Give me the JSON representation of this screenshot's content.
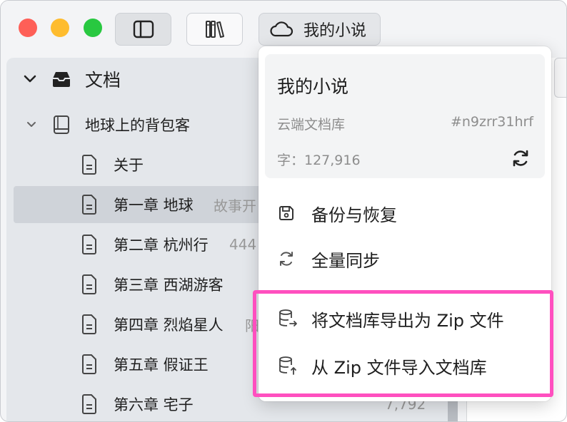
{
  "toolbar": {
    "sidebar_toggle_icon": "sidebar-icon",
    "library_icon": "books-icon",
    "cloud_icon": "cloud-icon",
    "cloud_label": "我的小说"
  },
  "sidebar": {
    "root": {
      "label": "文档",
      "icon": "tray-icon"
    },
    "book": {
      "label": "地球上的背包客",
      "icon": "book-icon"
    },
    "items": [
      {
        "label": "关于",
        "meta": "",
        "count": ""
      },
      {
        "label": "第一章 地球",
        "meta": "故事开",
        "count": ""
      },
      {
        "label": "第二章 杭州行",
        "meta": "444",
        "count": ""
      },
      {
        "label": "第三章 西湖游客",
        "meta": "",
        "count": ""
      },
      {
        "label": "第四章 烈焰星人",
        "meta": "阳",
        "count": ""
      },
      {
        "label": "第五章 假证王",
        "meta": "",
        "count": ""
      },
      {
        "label": "第六章 宅子",
        "meta": "",
        "count": "7,792"
      }
    ]
  },
  "menu": {
    "info": {
      "title": "我的小说",
      "type": "云端文档库",
      "id": "#n9zrr31hrf",
      "words": "字：127,916"
    },
    "items": [
      {
        "label": "备份与恢复",
        "icon": "backup-icon"
      },
      {
        "label": "全量同步",
        "icon": "sync-icon"
      },
      {
        "label": "将文档库导出为 Zip 文件",
        "icon": "database-export-icon"
      },
      {
        "label": "从 Zip 文件导入文档库",
        "icon": "database-import-icon"
      }
    ]
  },
  "colors": {
    "highlight": "#ff4fbf",
    "selected_row": "#cfd3d9",
    "traffic_red": "#fe5f57",
    "traffic_yellow": "#febc2e",
    "traffic_green": "#28c840"
  }
}
